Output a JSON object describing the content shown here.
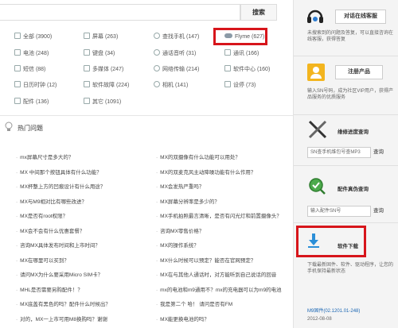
{
  "search": {
    "button_label": "搜索"
  },
  "categories": [
    {
      "label": "全部 (3900)",
      "icon": "grid-icon"
    },
    {
      "label": "屏幕 (263)",
      "icon": "screen-icon"
    },
    {
      "label": "查找手机 (147)",
      "icon": "locate-phone-icon"
    },
    {
      "label": "Flyme (627)",
      "icon": "cloud-icon"
    },
    {
      "label": "电池 (248)",
      "icon": "battery-icon"
    },
    {
      "label": "键盘 (34)",
      "icon": "keyboard-icon"
    },
    {
      "label": "通话音听 (31)",
      "icon": "phone-icon"
    },
    {
      "label": "通讯 (166)",
      "icon": "sms-icon"
    },
    {
      "label": "短信 (88)",
      "icon": "message-icon"
    },
    {
      "label": "多媒体 (247)",
      "icon": "media-icon"
    },
    {
      "label": "网络传输 (214)",
      "icon": "network-icon"
    },
    {
      "label": "软件中心 (160)",
      "icon": "app-center-icon"
    },
    {
      "label": "日历时钟 (12)",
      "icon": "calendar-icon"
    },
    {
      "label": "软件故障 (224)",
      "icon": "bug-icon"
    },
    {
      "label": "相机 (141)",
      "icon": "camera-icon"
    },
    {
      "label": "设停 (73)",
      "icon": "settings-icon"
    },
    {
      "label": "配件 (136)",
      "icon": "accessory-icon"
    },
    {
      "label": "其它 (1091)",
      "icon": "other-icon"
    }
  ],
  "hot": {
    "title": "热门问题",
    "left": [
      "mx屏幕尺寸是多大的？",
      "MX 中间那个按钮具体有什么功能？",
      "MX杯整上方的凹痕设计有什么用途？",
      "MX与M9相对比有哪些改进？",
      "MX是否有root权限？",
      "MX会不会有什么优惠套餐？",
      "咨询MX具体发布时间和上市时间？",
      "MX在哪里可以买到？",
      "请问MX为什么要采用Micro SIM卡？",
      "MHL是否需要另购配件！？",
      "MX底盖有黑色的吗？配件什么时候出？",
      "对的，MX一上市可用M8换购吗？谢谢"
    ],
    "right": [
      "MX的双摄像有什么功能可以用处？",
      "MX的双麦克风主动降噪功能有什么作用？",
      "MX会发热严重吗？",
      "MX屏幕分辨率是多少的？",
      "MX手机拍照最言清晰，是否有闪光灯和前置摄像头？",
      "咨询MX零售价格？",
      "MX的操作系统？",
      "MX什么时候可以预定？能否在官网预定？",
      "MX在与其他人通话时，对方能听到自己说话的回音",
      "mx的电池和m9通用不？mx的充电器可以为m9的电池",
      "我是第二个 哈！ 请问是否有FM",
      "MX能更换电池的吗？"
    ]
  },
  "sidebar": {
    "service_button": "对话在线客服",
    "service_note": "未搜索到的问题及答复，可以直接咨询在线客服，获得答复",
    "register_button": "注册产品",
    "register_note": "输入SN号码，成为社区VIP用户，获得产品服务的优质服务",
    "repair_label": "维修进度查询",
    "repair_placeholder": "SN查手机维包号查MP3",
    "repair_go": "查询",
    "accessory_label": "配件真伪查询",
    "accessory_placeholder": "输入配件SN号",
    "accessory_go": "查询",
    "download_button": "软件下载",
    "download_note": "下载最新固件、软件、驱动程序，让您的手机保持最新状态",
    "download_link": "M9固件(02.1201.01-248)",
    "download_date": "2012-08-08"
  }
}
